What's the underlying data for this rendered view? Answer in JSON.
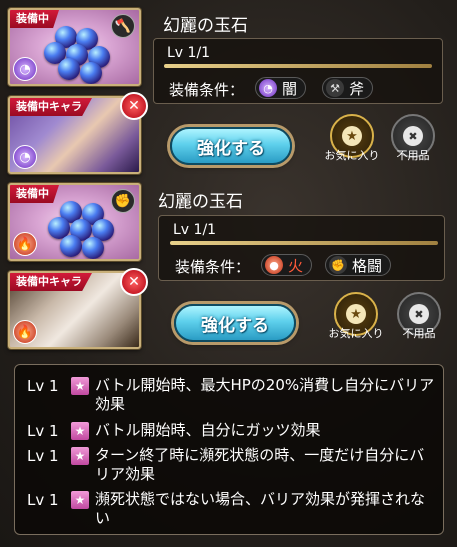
{
  "colors": {
    "equipped_ribbon": "#c8102e",
    "upgrade_button": "#4cc4e4",
    "frame_gold": "#c9b07a"
  },
  "items": [
    {
      "weapon_badge": "装備中",
      "char_badge": "装備中キャラ",
      "name": "幻麗の玉石",
      "level": "Lv 1/1",
      "condition_label": "装備条件：",
      "conditions": [
        {
          "icon": "dark-element-icon",
          "label": "闇"
        },
        {
          "icon": "axe-icon",
          "label": "斧"
        }
      ],
      "upgrade_label": "強化する",
      "favorite_label": "お気に入り",
      "junk_label": "不用品"
    },
    {
      "weapon_badge": "装備中",
      "char_badge": "装備中キャラ",
      "name": "幻麗の玉石",
      "level": "Lv 1/1",
      "condition_label": "装備条件：",
      "conditions": [
        {
          "icon": "fire-element-icon",
          "label": "火"
        },
        {
          "icon": "fist-icon",
          "label": "格闘"
        }
      ],
      "upgrade_label": "強化する",
      "favorite_label": "お気に入り",
      "junk_label": "不用品"
    }
  ],
  "effects": [
    {
      "level": "Lv 1",
      "text": "バトル開始時、最大HPの20%消費し自分にバリア効果"
    },
    {
      "level": "Lv 1",
      "text": "バトル開始時、自分にガッツ効果"
    },
    {
      "level": "Lv 1",
      "text": "ターン終了時に瀕死状態の時、一度だけ自分にバリア効果"
    },
    {
      "level": "Lv 1",
      "text": "瀕死状態ではない場合、バリア効果が発揮されない"
    }
  ]
}
